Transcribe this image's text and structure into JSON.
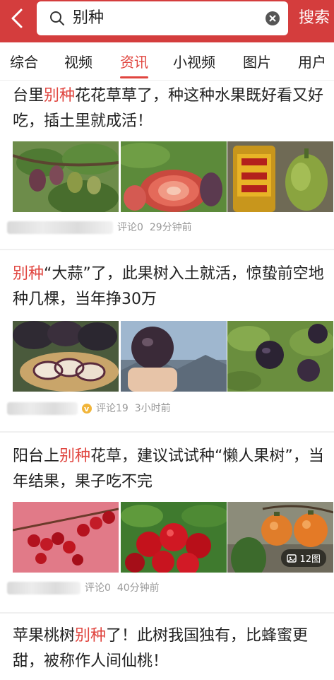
{
  "search": {
    "query": "别种",
    "submit_label": "搜索"
  },
  "tabs": [
    {
      "label": "综合"
    },
    {
      "label": "视频"
    },
    {
      "label": "资讯"
    },
    {
      "label": "小视频"
    },
    {
      "label": "图片"
    },
    {
      "label": "用户"
    }
  ],
  "active_tab": "资讯",
  "articles": [
    {
      "title_pre": "台里",
      "title_hl": "别种",
      "title_post": "花花草草了，种这种水果既好看又好吃，插土里就成活！",
      "comments": "评论0",
      "time": "29分钟前",
      "image_count": ""
    },
    {
      "title_pre": "",
      "title_hl": "别种",
      "title_post": "“大蒜”了，此果树入土就活，惊蛰前空地种几棵，当年挣30万",
      "comments": "评论19",
      "time": "3小时前",
      "image_count": ""
    },
    {
      "title_pre": "阳台上",
      "title_hl": "别种",
      "title_post": "花草，建议试试种“懒人果树”，当年结果，果子吃不完",
      "comments": "评论0",
      "time": "40分钟前",
      "image_count": "12图"
    },
    {
      "title_pre": "苹果桃树",
      "title_hl": "别种",
      "title_post": "了！此树我国独有，比蜂蜜更甜，被称作人间仙桃！",
      "comments": "",
      "time": "",
      "image_count": ""
    }
  ],
  "colors": {
    "header_bg": "#d43d3d",
    "accent": "#e0453f"
  }
}
